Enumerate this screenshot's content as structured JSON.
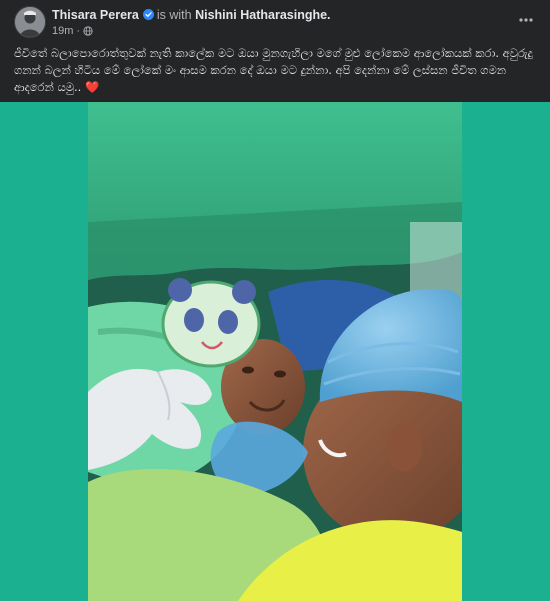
{
  "post": {
    "author": "Thisara Perera",
    "with_text": "is with",
    "tagged": "Nishini Hatharasinghe.",
    "time": "19m",
    "separator": "·",
    "privacy_icon": "globe-icon",
    "verified_icon": "verified-badge-icon",
    "more_icon": "more-options-icon",
    "text": "ජීවිතේ බලාපොරොත්තුවක් නැති කාලේක මට ඔයා මුනගැහිලා මගේ මුළු ලෝකෙම ආලෝකයක් කරා. අවුරුදු ගනන් බලන් හිටිය මේ ලෝකේ මං ආසම කරන දේ ඔයා මට දුන්නා. අපි දෙන්නා මේ ලස්සන ජීවිත ගමන ආදරෙන් යමු..",
    "emoji": "❤️"
  },
  "colors": {
    "background": "#242526",
    "frame": "#1bb190",
    "verified": "#2d88ff",
    "heart": "#f02849"
  },
  "photo": {
    "subject": "newborn-baby-with-father-in-hospital"
  }
}
